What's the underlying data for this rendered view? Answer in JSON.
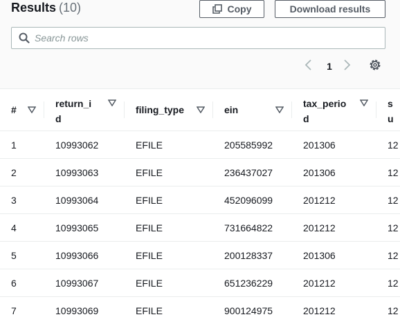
{
  "header": {
    "title": "Results",
    "count": "(10)"
  },
  "toolbar": {
    "copy_label": "Copy",
    "download_label": "Download results"
  },
  "search": {
    "placeholder": "Search rows",
    "value": ""
  },
  "pagination": {
    "current_page": "1"
  },
  "table": {
    "columns": [
      {
        "label": "#",
        "name": "col-index"
      },
      {
        "label": "return_id",
        "name": "col-return-id"
      },
      {
        "label": "filing_type",
        "name": "col-filing-type"
      },
      {
        "label": "ein",
        "name": "col-ein"
      },
      {
        "label": "tax_period",
        "name": "col-tax-period"
      },
      {
        "label": "su",
        "name": "col-sub-date"
      }
    ],
    "rows": [
      [
        "1",
        "10993062",
        "EFILE",
        "205585992",
        "201306",
        "12"
      ],
      [
        "2",
        "10993063",
        "EFILE",
        "236437027",
        "201306",
        "12"
      ],
      [
        "3",
        "10993064",
        "EFILE",
        "452096099",
        "201212",
        "12"
      ],
      [
        "4",
        "10993065",
        "EFILE",
        "731664822",
        "201212",
        "12"
      ],
      [
        "5",
        "10993066",
        "EFILE",
        "200128337",
        "201306",
        "12"
      ],
      [
        "6",
        "10993067",
        "EFILE",
        "651236229",
        "201212",
        "12"
      ],
      [
        "7",
        "10993069",
        "EFILE",
        "900124975",
        "201212",
        "12"
      ]
    ]
  },
  "colors": {
    "border": "#545b64",
    "text": "#16191f",
    "muted": "#687078",
    "divider": "#eaeded"
  },
  "icons": {
    "copy": "copy-icon",
    "search": "search-icon",
    "prev": "chevron-left-icon",
    "next": "chevron-right-icon",
    "settings": "gear-icon",
    "sort": "sort-caret-icon"
  }
}
